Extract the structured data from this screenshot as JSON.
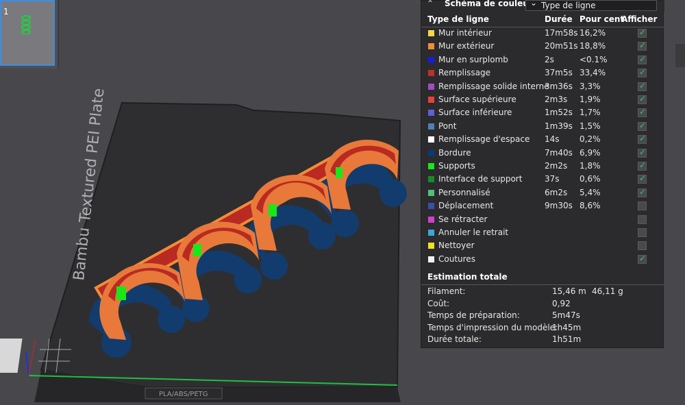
{
  "thumbnail": {
    "index": "1"
  },
  "plate": {
    "name": "Bambu Textured PEI Plate",
    "bottom_label": "PLA/ABS/PETG"
  },
  "legend": {
    "title": "Schéma de couleur",
    "scheme": "Type de ligne",
    "columns": {
      "type": "Type de ligne",
      "duration": "Durée",
      "percent": "Pour cent",
      "show": "Afficher"
    },
    "rows": [
      {
        "label": "Mur intérieur",
        "color": "#f7d64a",
        "duration": "17m58s",
        "percent": "16,2%",
        "shown": true
      },
      {
        "label": "Mur extérieur",
        "color": "#f28c38",
        "duration": "20m51s",
        "percent": "18,8%",
        "shown": true
      },
      {
        "label": "Mur en surplomb",
        "color": "#1a1ad8",
        "duration": "2s",
        "percent": "<0.1%",
        "shown": true
      },
      {
        "label": "Remplissage",
        "color": "#b83227",
        "duration": "37m5s",
        "percent": "33,4%",
        "shown": true
      },
      {
        "label": "Remplissage solide interne",
        "color": "#9b4fc2",
        "duration": "3m36s",
        "percent": "3,3%",
        "shown": true
      },
      {
        "label": "Surface supérieure",
        "color": "#e8413a",
        "duration": "2m3s",
        "percent": "1,9%",
        "shown": true
      },
      {
        "label": "Surface inférieure",
        "color": "#6060d8",
        "duration": "1m52s",
        "percent": "1,7%",
        "shown": true
      },
      {
        "label": "Pont",
        "color": "#4f7fb8",
        "duration": "1m39s",
        "percent": "1,5%",
        "shown": true
      },
      {
        "label": "Remplissage d'espace",
        "color": "#ffffff",
        "duration": "14s",
        "percent": "0,2%",
        "shown": true
      },
      {
        "label": "Bordure",
        "color": "#0a3a78",
        "duration": "7m40s",
        "percent": "6,9%",
        "shown": true
      },
      {
        "label": "Supports",
        "color": "#18e818",
        "duration": "2m2s",
        "percent": "1,8%",
        "shown": true
      },
      {
        "label": "Interface de support",
        "color": "#178a2a",
        "duration": "37s",
        "percent": "0,6%",
        "shown": true
      },
      {
        "label": "Personnalisé",
        "color": "#4fc27a",
        "duration": "6m2s",
        "percent": "5,4%",
        "shown": true
      },
      {
        "label": "Déplacement",
        "color": "#3a4fa8",
        "duration": "9m30s",
        "percent": "8,6%",
        "shown": false
      },
      {
        "label": "Se rétracter",
        "color": "#d040d0",
        "duration": "",
        "percent": "",
        "shown": false
      },
      {
        "label": "Annuler le retrait",
        "color": "#3aa8d8",
        "duration": "",
        "percent": "",
        "shown": false
      },
      {
        "label": "Nettoyer",
        "color": "#f0e020",
        "duration": "",
        "percent": "",
        "shown": false
      },
      {
        "label": "Coutures",
        "color": "#f2f2f2",
        "duration": "",
        "percent": "",
        "shown": true
      }
    ]
  },
  "estimate": {
    "title": "Estimation totale",
    "rows": [
      {
        "key": "Filament:",
        "value": "15,46 m",
        "value2": "46,11 g"
      },
      {
        "key": "Coût:",
        "value": "0,92",
        "value2": ""
      },
      {
        "key": "Temps de préparation:",
        "value": "5m47s",
        "value2": ""
      },
      {
        "key": "Temps d'impression du modèle:",
        "value": "1h45m",
        "value2": ""
      },
      {
        "key": "Durée totale:",
        "value": "1h51m",
        "value2": ""
      }
    ]
  }
}
